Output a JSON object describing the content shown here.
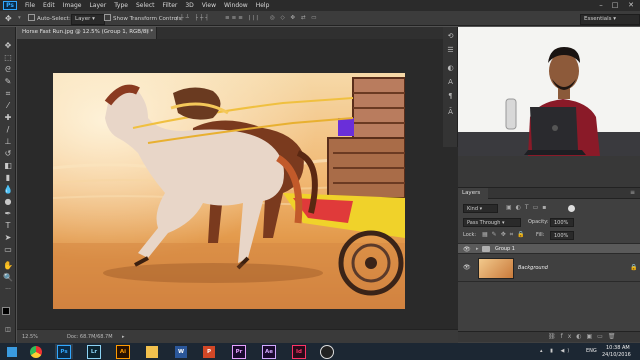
{
  "menubar": {
    "app_badge": "Ps",
    "items": [
      "File",
      "Edit",
      "Image",
      "Layer",
      "Type",
      "Select",
      "Filter",
      "3D",
      "View",
      "Window",
      "Help"
    ]
  },
  "options": {
    "auto_select_label": "Auto-Select:",
    "auto_select_value": "Layer",
    "transform_label": "Show Transform Controls",
    "workspace": "Essentials"
  },
  "document": {
    "tab_title": "Horse Fast Run.jpg @ 12.5% (Group 1, RGB/8) *",
    "zoom": "12.5%",
    "doc_info": "Doc: 68.7M/68.7M"
  },
  "layers_panel": {
    "tab_label": "Layers",
    "filter_kind": "Kind",
    "blend_mode": "Pass Through",
    "opacity_label": "Opacity:",
    "opacity_value": "100%",
    "lock_label": "Lock:",
    "fill_label": "Fill:",
    "fill_value": "100%",
    "layers": [
      {
        "name": "Group 1"
      },
      {
        "name": "Background"
      }
    ]
  },
  "taskbar": {
    "apps": [
      "Ps",
      "Lr",
      "Ai",
      "Pr",
      "Ae",
      "Id"
    ],
    "language": "ENG",
    "time": "10:38 AM",
    "date": "24/10/2016"
  },
  "colors": {
    "menubar": "#2b2b2b",
    "panel": "#383838",
    "canvas": "#2a2a2a",
    "ps_blue": "#31a8ff",
    "taskbar": "#1c2733"
  }
}
